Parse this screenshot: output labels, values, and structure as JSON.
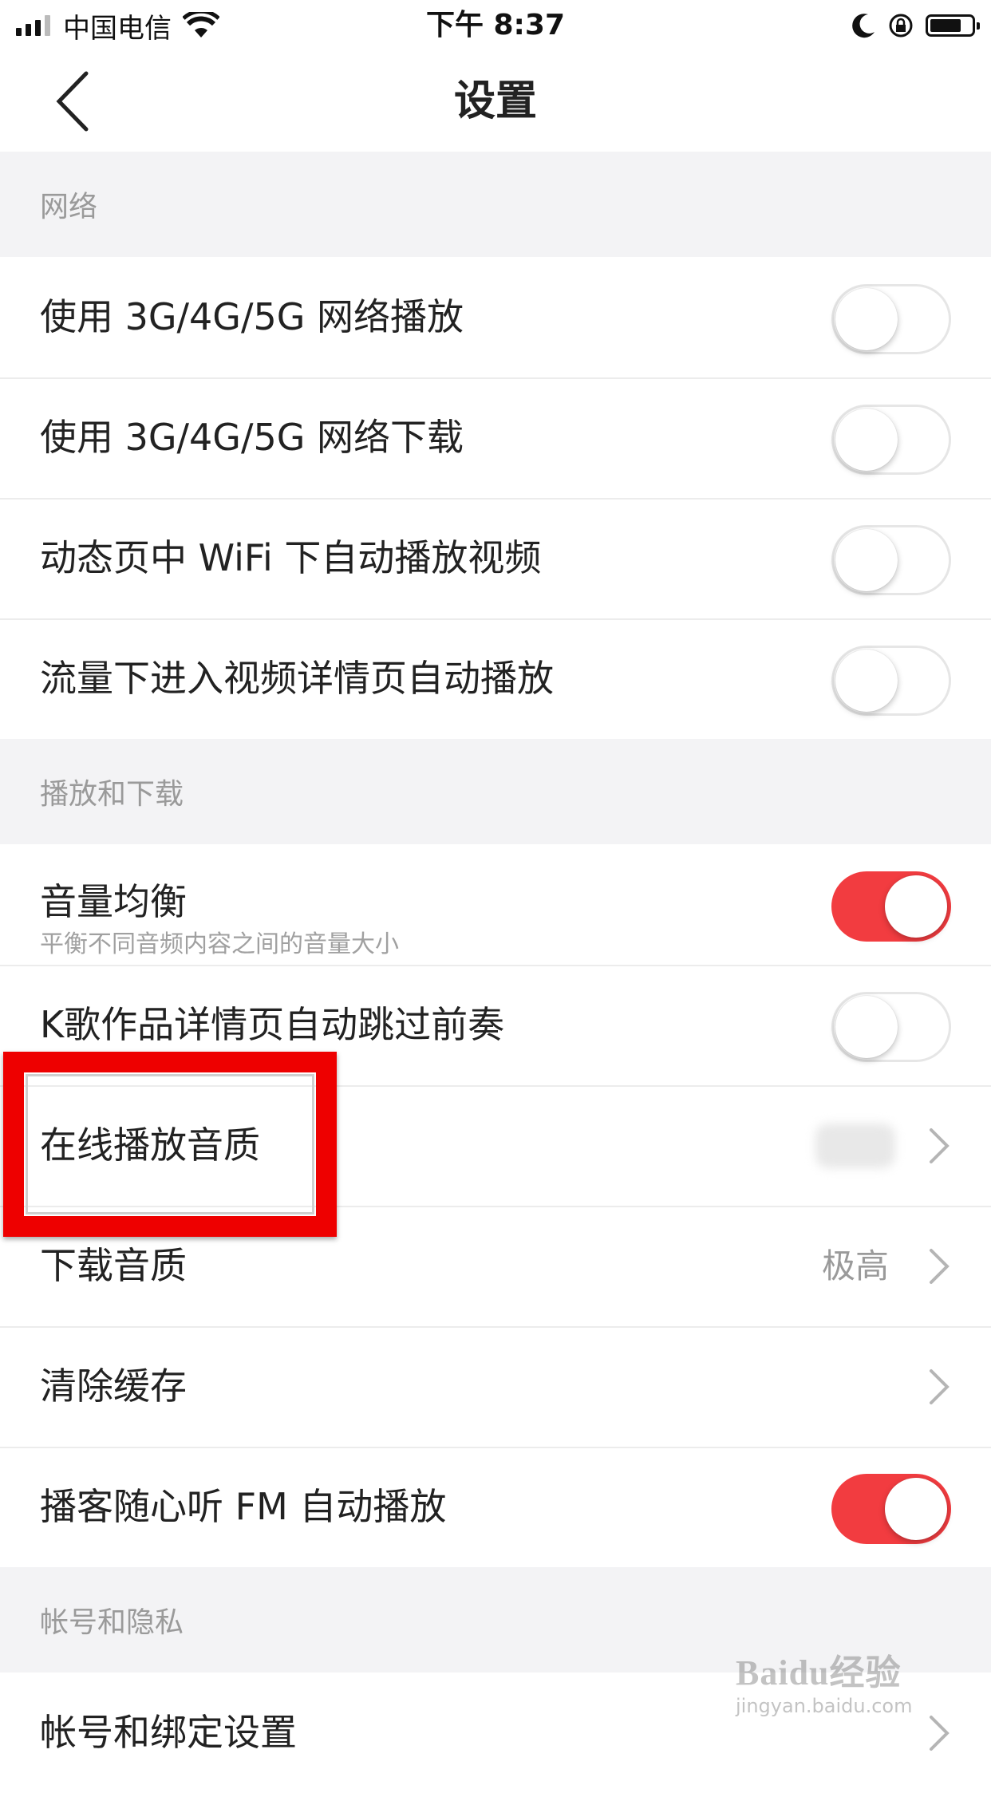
{
  "status_bar": {
    "carrier": "中国电信",
    "time": "下午 8:37",
    "icons": [
      "signal-icon",
      "wifi-icon",
      "moon-icon",
      "rotation-lock-icon",
      "battery-icon"
    ],
    "battery_level": 0.75
  },
  "nav": {
    "title": "设置",
    "back_icon": "chevron-left-icon"
  },
  "sections": {
    "network": {
      "header": "网络",
      "rows": [
        {
          "label": "使用 3G/4G/5G 网络播放",
          "toggle_on": false
        },
        {
          "label": "使用 3G/4G/5G 网络下载",
          "toggle_on": false
        },
        {
          "label": "动态页中 WiFi 下自动播放视频",
          "toggle_on": false
        },
        {
          "label": "流量下进入视频详情页自动播放",
          "toggle_on": false
        }
      ]
    },
    "playback": {
      "header": "播放和下载",
      "rows": [
        {
          "label": "音量均衡",
          "sublabel": "平衡不同音频内容之间的音量大小",
          "toggle_on": true
        },
        {
          "label": "K歌作品详情页自动跳过前奏",
          "toggle_on": false
        },
        {
          "label": "在线播放音质"
        },
        {
          "label": "下载音质",
          "value": "极高"
        },
        {
          "label": "清除缓存"
        },
        {
          "label": "播客随心听 FM 自动播放",
          "toggle_on": true
        }
      ]
    },
    "account": {
      "header": "帐号和隐私",
      "rows": [
        {
          "label": "帐号和绑定设置"
        }
      ]
    }
  },
  "colors": {
    "accent": "#f23c40",
    "highlight_box": "#ee0000",
    "section_bg": "#f3f3f5"
  },
  "watermark": {
    "logo": "Baidu经验",
    "url": "jingyan.baidu.com"
  }
}
